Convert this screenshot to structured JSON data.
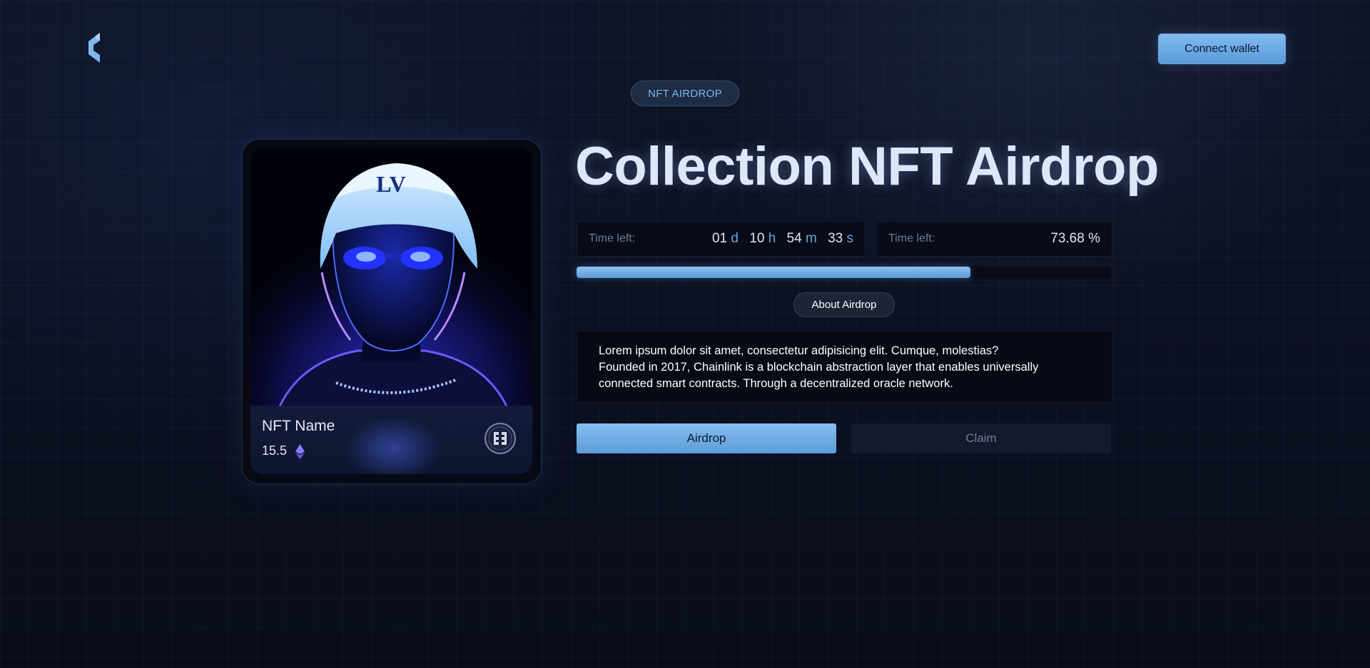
{
  "header": {
    "logo_icon": "brand-logo-icon",
    "connect_label": "Connect wallet"
  },
  "tag": {
    "label": "NFT AIRDROP"
  },
  "card": {
    "name": "NFT Name",
    "price": "15.5",
    "price_icon": "ethereum-icon",
    "badge_icon": "collection-badge-icon"
  },
  "hero": {
    "title": "Collection NFT Airdrop"
  },
  "timer": {
    "label": "Time left:",
    "days": "01",
    "days_unit": "d",
    "hours": "10",
    "hours_unit": "h",
    "minutes": "54",
    "minutes_unit": "m",
    "seconds": "33",
    "seconds_unit": "s"
  },
  "progress": {
    "label": "Time left:",
    "percent_text": "73.68 %",
    "value_fraction": 0.7368
  },
  "about": {
    "button_label": "About Airdrop",
    "lines": [
      "Lorem ipsum dolor sit amet, consectetur adipisicing elit. Cumque, molestias?",
      "Founded in 2017, Chainlink is a blockchain abstraction layer that enables universally",
      "connected smart contracts. Through a decentralized oracle network."
    ]
  },
  "actions": {
    "airdrop_label": "Airdrop",
    "claim_label": "Claim"
  },
  "colors": {
    "accent": "#6fb0ea",
    "background": "#0b1020",
    "panel": "#080c18"
  }
}
